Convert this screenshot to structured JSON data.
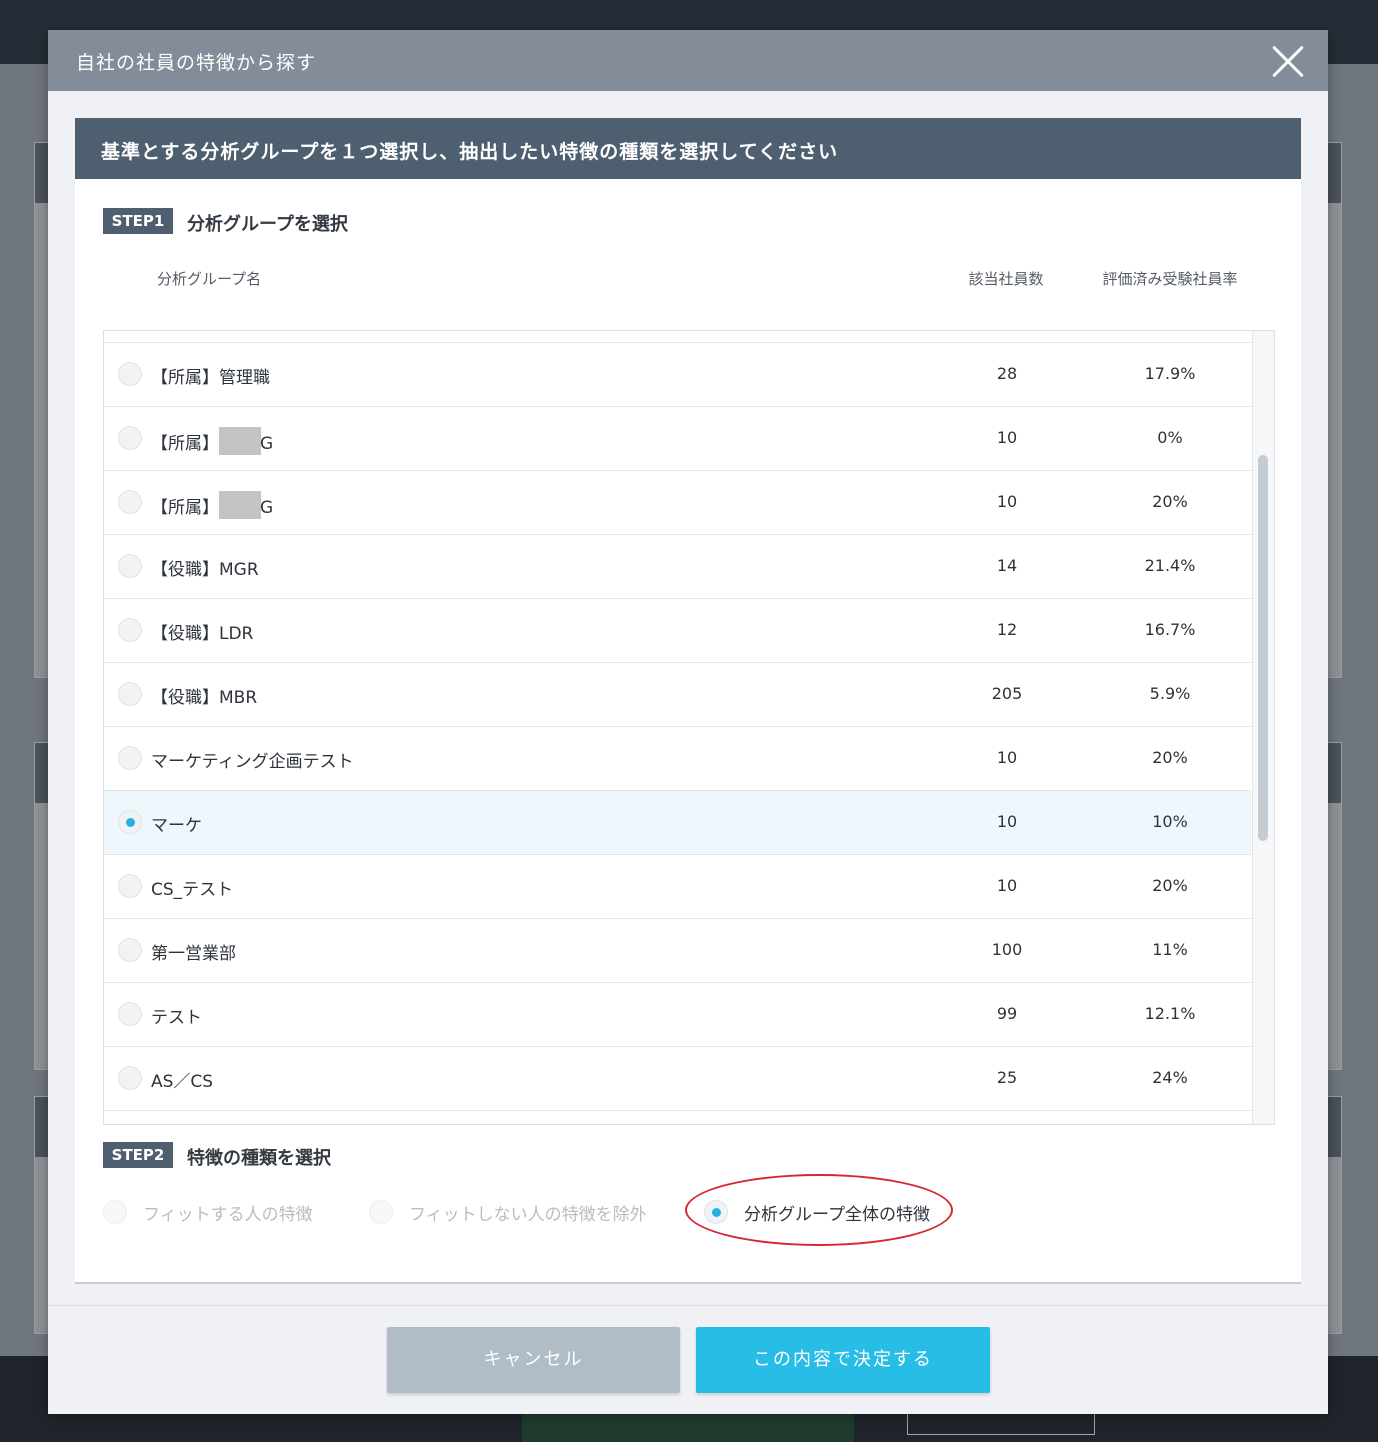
{
  "modal": {
    "title": "自社の社員の特徴から探す",
    "instruction": "基準とする分析グループを１つ選択し、抽出したい特徴の種類を選択してください",
    "close_icon": "close-icon"
  },
  "step1": {
    "badge": "STEP1",
    "title": "分析グループを選択",
    "columns": {
      "name": "分析グループ名",
      "count": "該当社員数",
      "rate": "評価済み受験社員率"
    },
    "rows": [
      {
        "name": "",
        "count": "",
        "rate": "",
        "selected": false
      },
      {
        "name": "【所属】管理職",
        "count": "28",
        "rate": "17.9%",
        "selected": false
      },
      {
        "name": "【所属】",
        "suffix": "G",
        "redacted": true,
        "count": "10",
        "rate": "0%",
        "selected": false
      },
      {
        "name": "【所属】",
        "suffix": "G",
        "redacted": true,
        "count": "10",
        "rate": "20%",
        "selected": false
      },
      {
        "name": "【役職】MGR",
        "count": "14",
        "rate": "21.4%",
        "selected": false
      },
      {
        "name": "【役職】LDR",
        "count": "12",
        "rate": "16.7%",
        "selected": false
      },
      {
        "name": "【役職】MBR",
        "count": "205",
        "rate": "5.9%",
        "selected": false
      },
      {
        "name": "マーケティング企画テスト",
        "count": "10",
        "rate": "20%",
        "selected": false
      },
      {
        "name": "マーケ",
        "count": "10",
        "rate": "10%",
        "selected": true
      },
      {
        "name": "CS_テスト",
        "count": "10",
        "rate": "20%",
        "selected": false
      },
      {
        "name": "第一営業部",
        "count": "100",
        "rate": "11%",
        "selected": false
      },
      {
        "name": "テスト",
        "count": "99",
        "rate": "12.1%",
        "selected": false
      },
      {
        "name": "AS／CS",
        "count": "25",
        "rate": "24%",
        "selected": false
      },
      {
        "name": "",
        "count": "",
        "rate": "",
        "selected": false
      }
    ]
  },
  "step2": {
    "badge": "STEP2",
    "title": "特徴の種類を選択",
    "options": [
      {
        "label": "フィットする人の特徴",
        "enabled": false,
        "selected": false
      },
      {
        "label": "フィットしない人の特徴を除外",
        "enabled": false,
        "selected": false
      },
      {
        "label": "分析グループ全体の特徴",
        "enabled": true,
        "selected": true
      }
    ]
  },
  "buttons": {
    "cancel": "キャンセル",
    "confirm": "この内容で決定する"
  },
  "colors": {
    "header": "#838c98",
    "banner": "#4e5f70",
    "accent": "#28bde6",
    "cancel": "#b0bcc6",
    "selected_row": "#eef8fc",
    "annotation": "#d8262d"
  }
}
